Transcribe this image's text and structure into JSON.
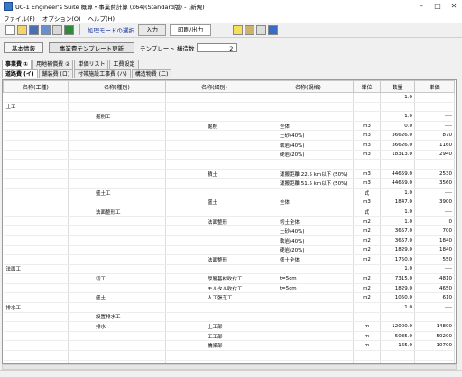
{
  "window": {
    "title": "UC-1 Engineer's Suite 概算・事業費計算 (x64)(Standard版) - (新規)"
  },
  "menu": [
    "ファイル(F)",
    "オプション(O)",
    "ヘルプ(H)"
  ],
  "toolbar": {
    "mode_label": "処理モードの選択",
    "input_label": "入力",
    "print_label": "印刷/出力"
  },
  "basic": {
    "basic_info_label": "基本情報",
    "update_label": "事業費テンプレート更新",
    "template_count_label": "テンプレート 構造数",
    "template_count_value": "2"
  },
  "tabs_main": [
    "事業費 ①",
    "用地補償費 ②",
    "単価リスト",
    "工費設定"
  ],
  "tabs_sub": [
    "道路費 (イ)",
    "舗装費 (ロ)",
    "付帯施設工事費 (ハ)",
    "構造物費 (二)"
  ],
  "columns": [
    "名称(工種)",
    "名称(種別)",
    "名称(細別)",
    "名称(規格)",
    "単位",
    "数量",
    "単価"
  ],
  "rows": [
    [
      "",
      "",
      "",
      "",
      "",
      "1.0",
      "----"
    ],
    [
      "土工",
      "",
      "",
      "",
      "",
      "",
      ""
    ],
    [
      "",
      "掘削工",
      "",
      "",
      "",
      "1.0",
      "----"
    ],
    [
      "",
      "",
      "掘削",
      "全体",
      "m3",
      "0.0",
      "----"
    ],
    [
      "",
      "",
      "",
      "土砂(40%)",
      "m3",
      "36626.0",
      "870"
    ],
    [
      "",
      "",
      "",
      "軟岩(40%)",
      "m3",
      "36626.0",
      "1160"
    ],
    [
      "",
      "",
      "",
      "硬岩(20%)",
      "m3",
      "18313.0",
      "2940"
    ],
    [
      "",
      "",
      "",
      "",
      "",
      "",
      ""
    ],
    [
      "",
      "",
      "積土",
      "運搬距離 22.5 km以下 (50%)",
      "m3",
      "44659.0",
      "2530"
    ],
    [
      "",
      "",
      "",
      "運搬距離 51.5 km以下 (50%)",
      "m3",
      "44659.0",
      "3560"
    ],
    [
      "",
      "盛土工",
      "",
      "",
      "式",
      "1.0",
      "----"
    ],
    [
      "",
      "",
      "盛土",
      "全体",
      "m3",
      "1847.0",
      "3900"
    ],
    [
      "",
      "法面整形工",
      "",
      "",
      "式",
      "1.0",
      "----"
    ],
    [
      "",
      "",
      "法面整形",
      "切土全体",
      "m2",
      "1.0",
      "0"
    ],
    [
      "",
      "",
      "",
      "土砂(40%)",
      "m2",
      "3657.0",
      "700"
    ],
    [
      "",
      "",
      "",
      "軟岩(40%)",
      "m2",
      "3657.0",
      "1840"
    ],
    [
      "",
      "",
      "",
      "硬岩(20%)",
      "m2",
      "1829.0",
      "1840"
    ],
    [
      "",
      "",
      "法面整形",
      "盛土全体",
      "m2",
      "1750.0",
      "550"
    ],
    [
      "法面工",
      "",
      "",
      "",
      "",
      "1.0",
      "----"
    ],
    [
      "",
      "切工",
      "厚層基材吹付工",
      "t=5cm",
      "m2",
      "7315.0",
      "4810"
    ],
    [
      "",
      "",
      "モルタル吹付工",
      "t=5cm",
      "m2",
      "1829.0",
      "4650"
    ],
    [
      "",
      "盛土",
      "人工張芝工",
      "",
      "m2",
      "1050.0",
      "610"
    ],
    [
      "排水工",
      "",
      "",
      "",
      "",
      "1.0",
      "----"
    ],
    [
      "",
      "設置排水工",
      "",
      "",
      "",
      "",
      ""
    ],
    [
      "",
      "排水",
      "土工部",
      "",
      "m",
      "12000.0",
      "14800"
    ],
    [
      "",
      "",
      "工工部",
      "",
      "m",
      "5035.0",
      "50200"
    ],
    [
      "",
      "",
      "橋梁部",
      "",
      "m",
      "165.0",
      "10700"
    ],
    [
      "",
      "",
      "",
      "",
      "",
      "",
      ""
    ],
    [
      "",
      "",
      "",
      "",
      "",
      "",
      ""
    ],
    [
      "",
      "",
      "",
      "",
      "",
      "",
      ""
    ]
  ]
}
